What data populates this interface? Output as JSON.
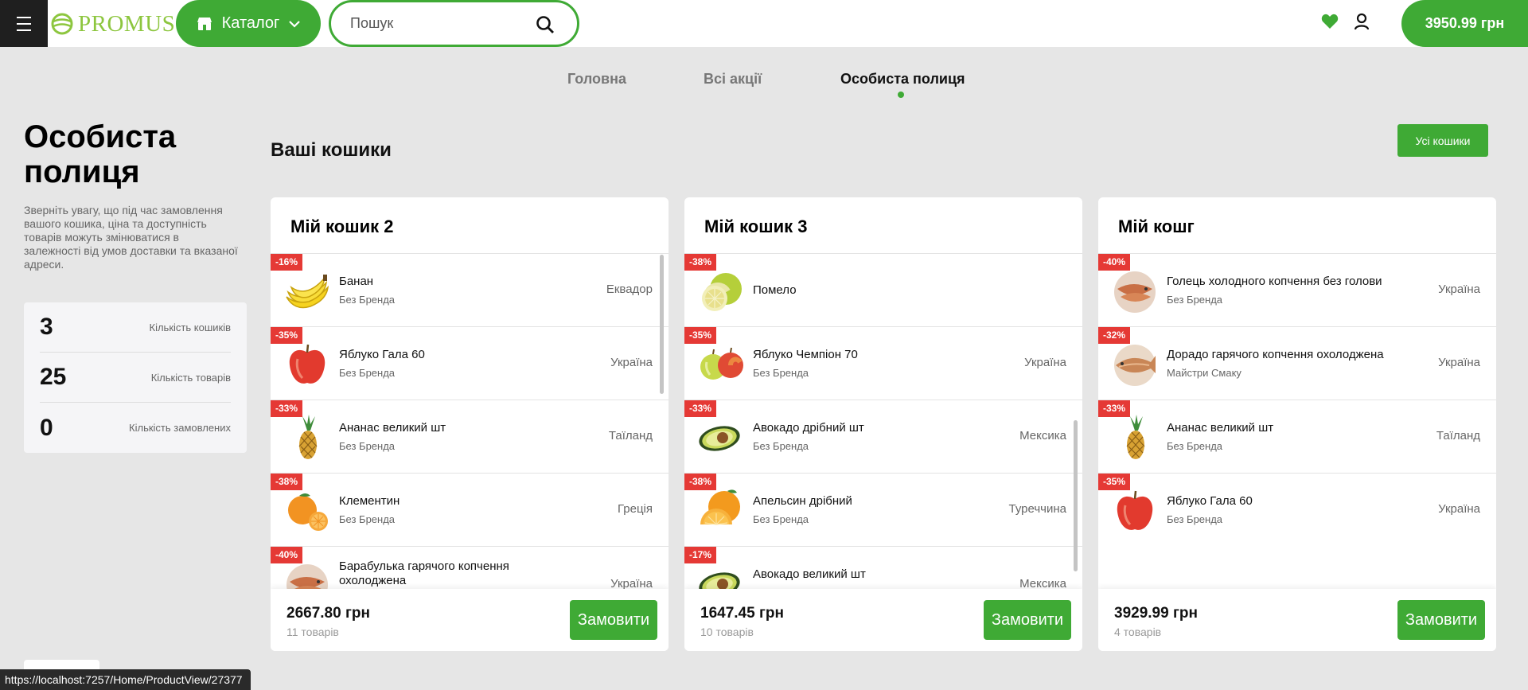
{
  "header": {
    "logo_text": "PROMUS",
    "catalog_label": "Каталог",
    "search_placeholder": "Пошук",
    "cart_total": "3950.99 грн"
  },
  "nav": {
    "items": [
      {
        "label": "Головна"
      },
      {
        "label": "Всі акції"
      },
      {
        "label": "Особиста полиця"
      }
    ]
  },
  "sidebar": {
    "title_line1": "Особиста",
    "title_line2": "полиця",
    "description": "Зверніть увагу, що під час замовлення вашого кошика, ціна та доступність товарів можуть змінюватися в залежності від умов доставки та вказаної адреси.",
    "stats": [
      {
        "value": "3",
        "label": "Кількість кошиків"
      },
      {
        "value": "25",
        "label": "Кількість товарів"
      },
      {
        "value": "0",
        "label": "Кількість замовлених"
      }
    ]
  },
  "main": {
    "section_title": "Ваші кошики",
    "all_carts_label": "Усі кошики",
    "carts": [
      {
        "title": "Мій кошик 2",
        "total": "2667.80 грн",
        "count": "11 товарів",
        "order_label": "Замовити",
        "items": [
          {
            "discount": "-16%",
            "name": "Банан",
            "brand": "Без Бренда",
            "country": "Еквадор",
            "icon": "banana-icon"
          },
          {
            "discount": "-35%",
            "name": "Яблуко Гала 60",
            "brand": "Без Бренда",
            "country": "Україна",
            "icon": "red-apple-icon"
          },
          {
            "discount": "-33%",
            "name": "Ананас великий шт",
            "brand": "Без Бренда",
            "country": "Таїланд",
            "icon": "pineapple-icon"
          },
          {
            "discount": "-38%",
            "name": "Клементин",
            "brand": "Без Бренда",
            "country": "Греція",
            "icon": "clementine-icon"
          },
          {
            "discount": "-40%",
            "name": "Барабулька гарячого копчення охолоджена",
            "brand": "",
            "country": "Україна",
            "icon": "smoked-fish-icon"
          }
        ]
      },
      {
        "title": "Мій кошик 3",
        "total": "1647.45 грн",
        "count": "10 товарів",
        "order_label": "Замовити",
        "items": [
          {
            "discount": "-38%",
            "name": "Помело",
            "brand": "",
            "country": "",
            "icon": "pomelo-icon"
          },
          {
            "discount": "-35%",
            "name": "Яблуко Чемпіон 70",
            "brand": "Без Бренда",
            "country": "Україна",
            "icon": "apples-icon"
          },
          {
            "discount": "-33%",
            "name": "Авокадо дрібний шт",
            "brand": "Без Бренда",
            "country": "Мексика",
            "icon": "avocado-icon"
          },
          {
            "discount": "-38%",
            "name": "Апельсин дрібний",
            "brand": "Без Бренда",
            "country": "Туреччина",
            "icon": "orange-icon"
          },
          {
            "discount": "-17%",
            "name": "Авокадо великий шт",
            "brand": "",
            "country": "Мексика",
            "icon": "avocado-icon"
          }
        ]
      },
      {
        "title": "Мій кошг",
        "total": "3929.99 грн",
        "count": "4 товарів",
        "order_label": "Замовити",
        "items": [
          {
            "discount": "-40%",
            "name": "Голець холодного копчення без голови",
            "brand": "Без Бренда",
            "country": "Україна",
            "icon": "smoked-fish-icon"
          },
          {
            "discount": "-32%",
            "name": "Дорадо гарячого копчення охолоджена",
            "brand": "Майстри Смаку",
            "country": "Україна",
            "icon": "dorado-fish-icon"
          },
          {
            "discount": "-33%",
            "name": "Ананас великий шт",
            "brand": "Без Бренда",
            "country": "Таїланд",
            "icon": "pineapple-icon"
          },
          {
            "discount": "-35%",
            "name": "Яблуко Гала 60",
            "brand": "Без Бренда",
            "country": "Україна",
            "icon": "red-apple-icon"
          }
        ]
      }
    ]
  },
  "status_bar": {
    "url": "https://localhost:7257/Home/ProductView/27377"
  },
  "colors": {
    "accent": "#3faa35",
    "discount": "#e53935",
    "logo": "#8dc63f"
  }
}
